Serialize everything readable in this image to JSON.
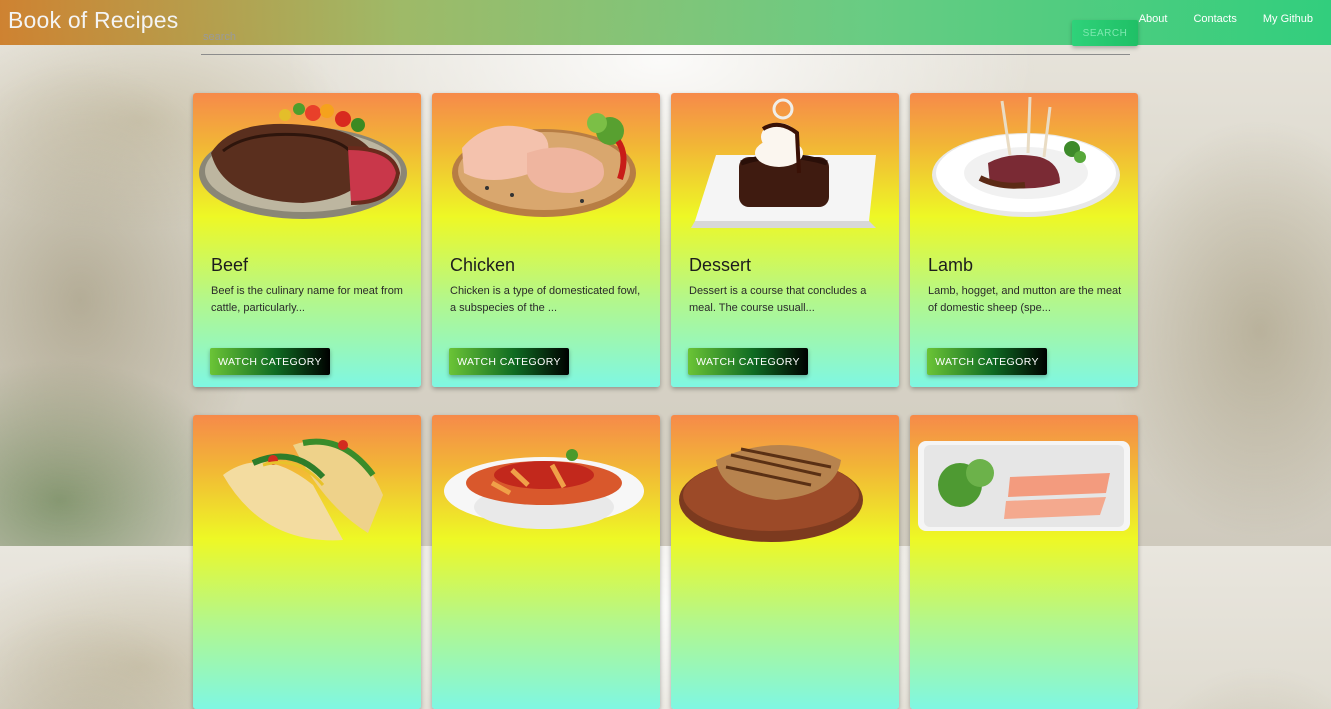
{
  "header": {
    "brand": "Book of Recipes",
    "nav": [
      {
        "label": "About"
      },
      {
        "label": "Contacts"
      },
      {
        "label": "My Github"
      }
    ]
  },
  "search": {
    "placeholder": "search",
    "value": "",
    "button_label": "SEARCH"
  },
  "categories": [
    {
      "title": "Beef",
      "description": "Beef is the culinary name for meat from cattle, particularly...",
      "button_label": "WATCH CATEGORY",
      "image": "beef-steak-image"
    },
    {
      "title": "Chicken",
      "description": "Chicken is a type of domesticated fowl, a subspecies of the ...",
      "button_label": "WATCH CATEGORY",
      "image": "raw-chicken-image"
    },
    {
      "title": "Dessert",
      "description": "Dessert is a course that concludes a meal. The course usuall...",
      "button_label": "WATCH CATEGORY",
      "image": "chocolate-dessert-image"
    },
    {
      "title": "Lamb",
      "description": "Lamb, hogget, and mutton are the meat of domestic sheep (spe...",
      "button_label": "WATCH CATEGORY",
      "image": "lamb-chops-image"
    },
    {
      "image": "tacos-image"
    },
    {
      "image": "pasta-image"
    },
    {
      "image": "grilled-pork-image"
    },
    {
      "image": "seafood-salmon-image"
    }
  ],
  "colors": {
    "card_top": "#f68a4a",
    "card_middle": "#eef825",
    "card_bottom": "#7ff7e2",
    "button_start": "#6bc436",
    "button_end": "#000000",
    "search_button": "#2fd27a"
  }
}
